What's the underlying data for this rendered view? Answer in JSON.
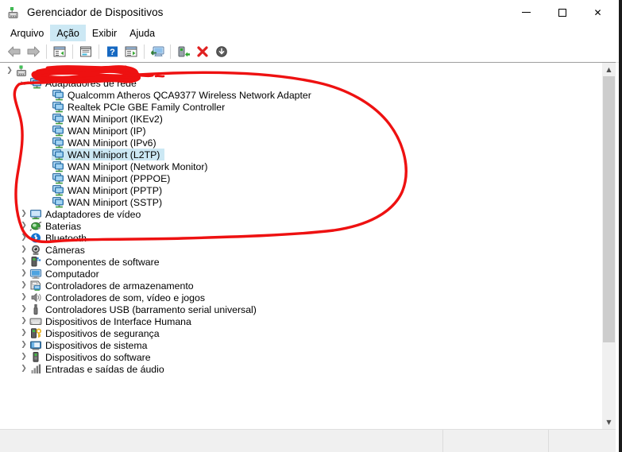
{
  "window": {
    "title": "Gerenciador de Dispositivos",
    "title_icon": "device-manager-icon",
    "caption": {
      "minimize": "minimize-icon",
      "maximize": "maximize-icon",
      "close": "close-icon"
    }
  },
  "menubar": {
    "items": [
      {
        "label": "Arquivo",
        "active": false
      },
      {
        "label": "Ação",
        "active": true
      },
      {
        "label": "Exibir",
        "active": false
      },
      {
        "label": "Ajuda",
        "active": false
      }
    ]
  },
  "toolbar": {
    "buttons": [
      {
        "name": "back-arrow-icon",
        "tip": "Voltar"
      },
      {
        "name": "forward-arrow-icon",
        "tip": "Avançar"
      },
      {
        "name": "show-hide-console-tree-icon",
        "tip": "Mostrar/ocultar árvore do console"
      },
      {
        "name": "properties-icon",
        "tip": "Propriedades"
      },
      {
        "name": "help-icon",
        "tip": "Ajuda"
      },
      {
        "name": "update-driver-icon",
        "tip": "Atualizar driver"
      },
      {
        "name": "scan-hardware-changes-icon",
        "tip": "Verificar se há alterações de hardware"
      },
      {
        "name": "enable-device-icon",
        "tip": "Habilitar dispositivo"
      },
      {
        "name": "uninstall-device-icon",
        "tip": "Desinstalar dispositivo"
      },
      {
        "name": "disable-device-icon",
        "tip": "Desabilitar dispositivo"
      }
    ]
  },
  "tree": {
    "root": {
      "label": "",
      "redacted": true,
      "icon": "computer-root-icon",
      "expanded": true
    },
    "nodes": [
      {
        "level": 1,
        "label": "Adaptadores de rede",
        "icon": "network-adapter-icon",
        "expanded": true,
        "has_children": true,
        "selected": false
      },
      {
        "level": 2,
        "label": "Qualcomm Atheros QCA9377 Wireless Network Adapter",
        "icon": "network-adapter-icon",
        "expanded": false,
        "has_children": false,
        "selected": false
      },
      {
        "level": 2,
        "label": "Realtek PCIe GBE Family Controller",
        "icon": "network-adapter-icon",
        "expanded": false,
        "has_children": false,
        "selected": false
      },
      {
        "level": 2,
        "label": "WAN Miniport (IKEv2)",
        "icon": "network-adapter-icon",
        "expanded": false,
        "has_children": false,
        "selected": false
      },
      {
        "level": 2,
        "label": "WAN Miniport (IP)",
        "icon": "network-adapter-icon",
        "expanded": false,
        "has_children": false,
        "selected": false
      },
      {
        "level": 2,
        "label": "WAN Miniport (IPv6)",
        "icon": "network-adapter-icon",
        "expanded": false,
        "has_children": false,
        "selected": false
      },
      {
        "level": 2,
        "label": "WAN Miniport (L2TP)",
        "icon": "network-adapter-icon",
        "expanded": false,
        "has_children": false,
        "selected": true
      },
      {
        "level": 2,
        "label": "WAN Miniport (Network Monitor)",
        "icon": "network-adapter-icon",
        "expanded": false,
        "has_children": false,
        "selected": false
      },
      {
        "level": 2,
        "label": "WAN Miniport (PPPOE)",
        "icon": "network-adapter-icon",
        "expanded": false,
        "has_children": false,
        "selected": false
      },
      {
        "level": 2,
        "label": "WAN Miniport (PPTP)",
        "icon": "network-adapter-icon",
        "expanded": false,
        "has_children": false,
        "selected": false
      },
      {
        "level": 2,
        "label": "WAN Miniport (SSTP)",
        "icon": "network-adapter-icon",
        "expanded": false,
        "has_children": false,
        "selected": false
      },
      {
        "level": 1,
        "label": "Adaptadores de vídeo",
        "icon": "display-adapter-icon",
        "expanded": false,
        "has_children": true,
        "selected": false
      },
      {
        "level": 1,
        "label": "Baterias",
        "icon": "battery-icon",
        "expanded": false,
        "has_children": true,
        "selected": false
      },
      {
        "level": 1,
        "label": "Bluetooth",
        "icon": "bluetooth-icon",
        "expanded": false,
        "has_children": true,
        "selected": false
      },
      {
        "level": 1,
        "label": "Câmeras",
        "icon": "camera-icon",
        "expanded": false,
        "has_children": true,
        "selected": false
      },
      {
        "level": 1,
        "label": "Componentes de software",
        "icon": "software-component-icon",
        "expanded": false,
        "has_children": true,
        "selected": false
      },
      {
        "level": 1,
        "label": "Computador",
        "icon": "monitor-icon",
        "expanded": false,
        "has_children": true,
        "selected": false
      },
      {
        "level": 1,
        "label": "Controladores de armazenamento",
        "icon": "storage-controller-icon",
        "expanded": false,
        "has_children": true,
        "selected": false
      },
      {
        "level": 1,
        "label": "Controladores de som, vídeo e jogos",
        "icon": "speaker-icon",
        "expanded": false,
        "has_children": true,
        "selected": false
      },
      {
        "level": 1,
        "label": "Controladores USB (barramento serial universal)",
        "icon": "usb-icon",
        "expanded": false,
        "has_children": true,
        "selected": false
      },
      {
        "level": 1,
        "label": "Dispositivos de Interface Humana",
        "icon": "hid-keyboard-icon",
        "expanded": false,
        "has_children": true,
        "selected": false
      },
      {
        "level": 1,
        "label": "Dispositivos de segurança",
        "icon": "security-device-icon",
        "expanded": false,
        "has_children": true,
        "selected": false
      },
      {
        "level": 1,
        "label": "Dispositivos de sistema",
        "icon": "system-device-icon",
        "expanded": false,
        "has_children": true,
        "selected": false
      },
      {
        "level": 1,
        "label": "Dispositivos do software",
        "icon": "software-device-icon",
        "expanded": false,
        "has_children": true,
        "selected": false
      },
      {
        "level": 1,
        "label": "Entradas e saídas de áudio",
        "icon": "audio-io-icon",
        "expanded": false,
        "has_children": true,
        "selected": false
      }
    ]
  },
  "scrollbar": {
    "up_arrow": "scroll-up-icon",
    "down_arrow": "scroll-down-icon"
  },
  "statusbar": {
    "pane1": "",
    "pane2": "",
    "pane3": ""
  },
  "annotation": {
    "color": "#ee1111",
    "marks": [
      {
        "type": "scribble",
        "target": "computer-name-redaction"
      },
      {
        "type": "ellipse",
        "target": "network-adapters-group"
      }
    ]
  },
  "colors": {
    "selection": "#cce8f4",
    "menu_hover": "#cce8f4",
    "annotation_red": "#ee1111",
    "scroll_thumb": "#cdcdcd",
    "status_bg": "#f0f0f0"
  }
}
